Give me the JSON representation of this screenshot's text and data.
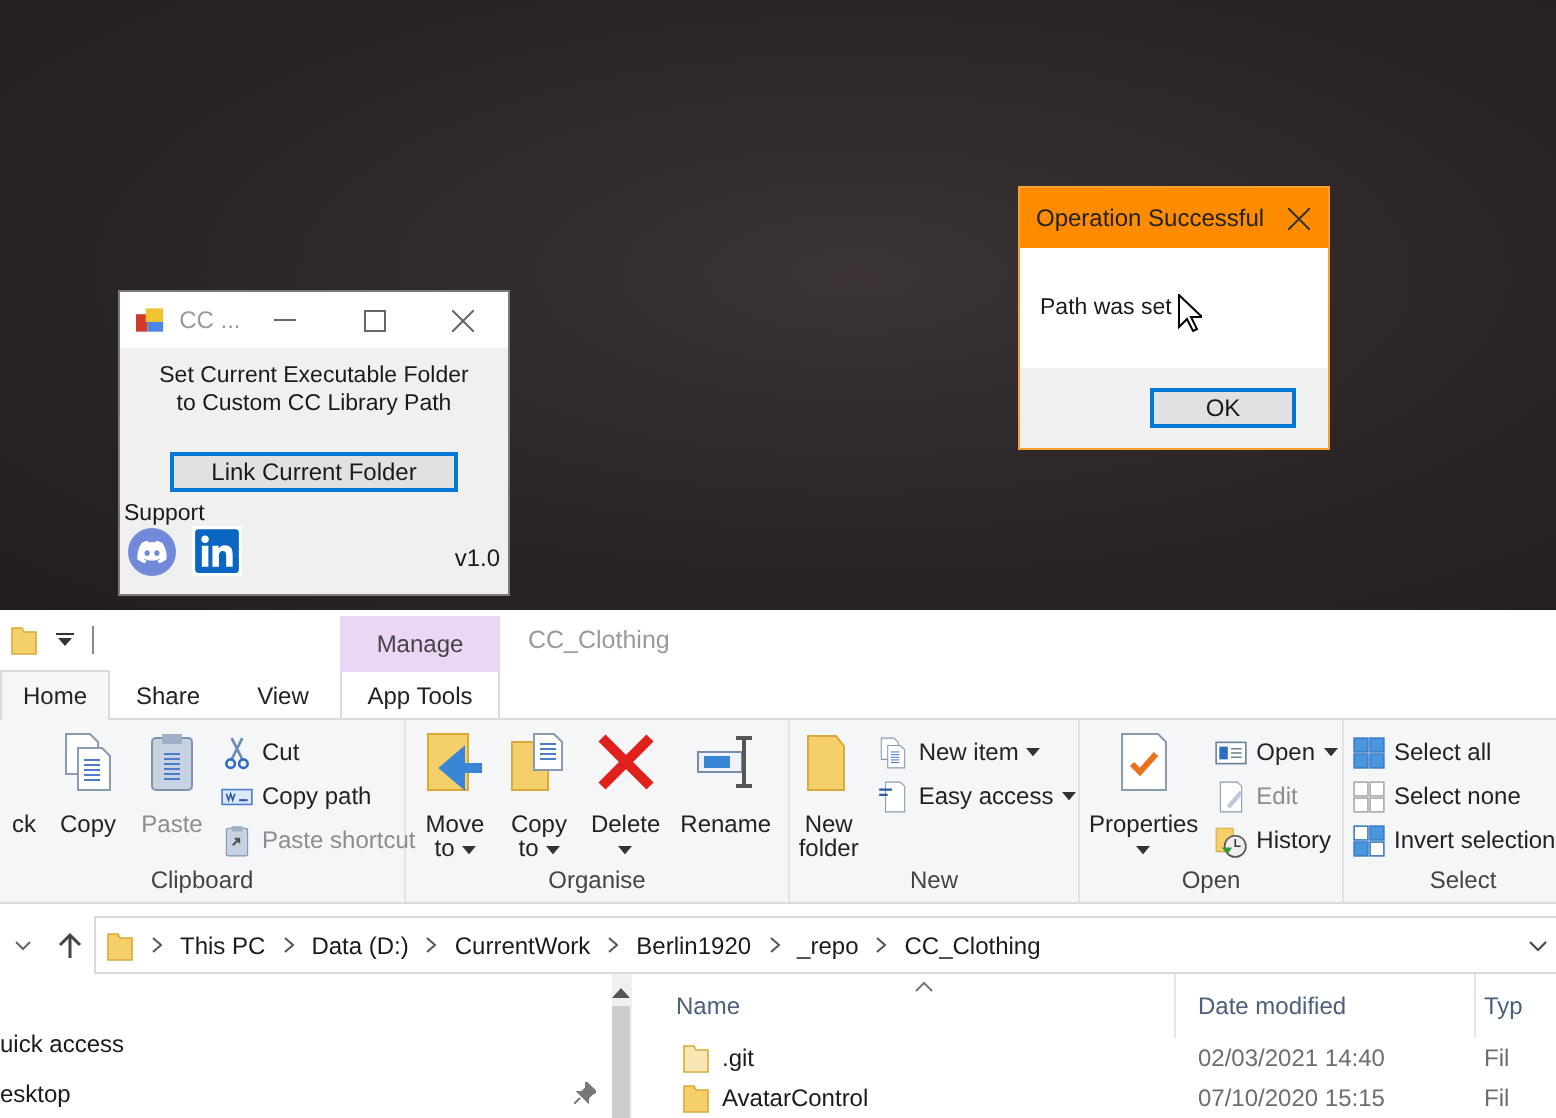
{
  "desktop": {
    "cc_window": {
      "title": "CC ...",
      "description": [
        "Set Current Executable Folder",
        "to Custom CC Library Path"
      ],
      "button": "Link Current Folder",
      "support_label": "Support",
      "version": "v1.0"
    },
    "dialog": {
      "title": "Operation Successful",
      "message": "Path was set",
      "button": "OK"
    }
  },
  "explorer": {
    "title": "CC_Clothing",
    "context_tab": "Manage",
    "tabs": [
      {
        "label": "Home",
        "selected": true
      },
      {
        "label": "Share",
        "selected": false
      },
      {
        "label": "View",
        "selected": false
      },
      {
        "label": "App Tools",
        "selected": false
      }
    ],
    "ribbon_groups": [
      {
        "label": "Clipboard",
        "items": [
          {
            "kind": "large",
            "label": "ck",
            "dropdown": false,
            "disabled": false
          },
          {
            "kind": "large",
            "label": "Copy",
            "dropdown": false,
            "disabled": false
          },
          {
            "kind": "large",
            "label": "Paste",
            "dropdown": false,
            "disabled": true
          },
          {
            "kind": "small",
            "label": "Cut",
            "dropdown": false,
            "disabled": false
          },
          {
            "kind": "small",
            "label": "Copy path",
            "dropdown": false,
            "disabled": false
          },
          {
            "kind": "small",
            "label": "Paste shortcut",
            "dropdown": false,
            "disabled": true
          }
        ]
      },
      {
        "label": "Organise",
        "items": [
          {
            "kind": "large",
            "label": "Move to",
            "dropdown": true,
            "disabled": false
          },
          {
            "kind": "large",
            "label": "Copy to",
            "dropdown": true,
            "disabled": false
          },
          {
            "kind": "large",
            "label": "Delete",
            "dropdown": true,
            "disabled": false
          },
          {
            "kind": "large",
            "label": "Rename",
            "dropdown": false,
            "disabled": false
          }
        ]
      },
      {
        "label": "New",
        "items": [
          {
            "kind": "large",
            "label": "New folder",
            "dropdown": false,
            "disabled": false
          },
          {
            "kind": "small",
            "label": "New item",
            "dropdown": true,
            "disabled": false
          },
          {
            "kind": "small",
            "label": "Easy access",
            "dropdown": true,
            "disabled": false
          }
        ]
      },
      {
        "label": "Open",
        "items": [
          {
            "kind": "large",
            "label": "Properties",
            "dropdown": true,
            "disabled": false
          },
          {
            "kind": "small",
            "label": "Open",
            "dropdown": true,
            "disabled": false
          },
          {
            "kind": "small",
            "label": "Edit",
            "dropdown": false,
            "disabled": true
          },
          {
            "kind": "small",
            "label": "History",
            "dropdown": false,
            "disabled": false
          }
        ]
      },
      {
        "label": "Select",
        "items": [
          {
            "kind": "small",
            "label": "Select all",
            "dropdown": false,
            "disabled": false
          },
          {
            "kind": "small",
            "label": "Select none",
            "dropdown": false,
            "disabled": false
          },
          {
            "kind": "small",
            "label": "Invert selection",
            "dropdown": false,
            "disabled": false
          }
        ]
      }
    ],
    "breadcrumbs": [
      "This PC",
      "Data (D:)",
      "CurrentWork",
      "Berlin1920",
      "_repo",
      "CC_Clothing"
    ],
    "nav_items": [
      {
        "label": "uick access",
        "pinned": false
      },
      {
        "label": "esktop",
        "pinned": true
      }
    ],
    "columns": [
      "Name",
      "Date modified",
      "Typ"
    ],
    "rows": [
      {
        "name": ".git",
        "date": "02/03/2021 14:40",
        "type": "Fil"
      },
      {
        "name": "AvatarControl",
        "date": "07/10/2020 15:15",
        "type": "Fil"
      }
    ]
  }
}
